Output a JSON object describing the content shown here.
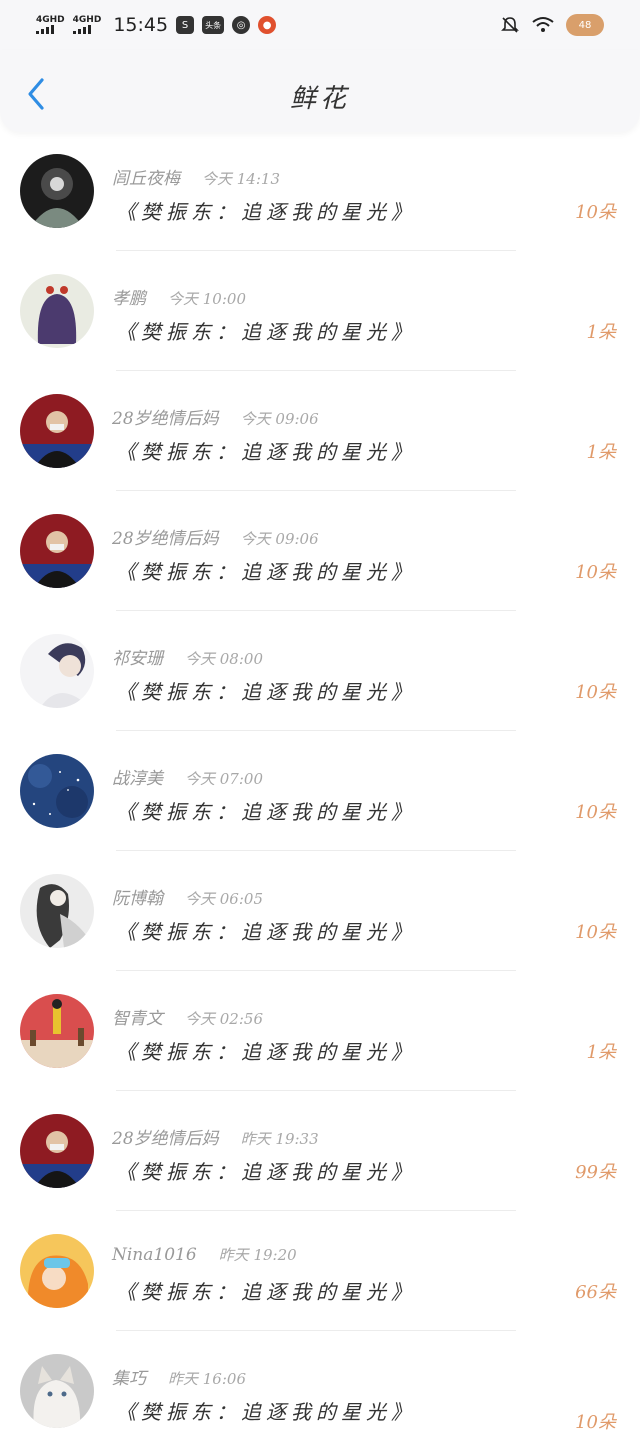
{
  "status_bar": {
    "net1": "4GHD",
    "net2": "4GHD",
    "time": "15:45",
    "app_toutiao": "头条",
    "battery": "48"
  },
  "nav": {
    "title": "鲜花"
  },
  "items": [
    {
      "name": "闾丘夜梅",
      "time": "今天 14:13",
      "title": "《樊振东：追逐我的星光》",
      "count": "10朵",
      "avatar": "avatar-dark-art"
    },
    {
      "name": "孝鹏",
      "time": "今天 10:00",
      "title": "《樊振东：追逐我的星光》",
      "count": "1朵",
      "avatar": "avatar-purple-hair"
    },
    {
      "name": "28岁绝情后妈",
      "time": "今天 09:06",
      "title": "《樊振东：追逐我的星光》",
      "count": "1朵",
      "avatar": "avatar-athlete"
    },
    {
      "name": "28岁绝情后妈",
      "time": "今天 09:06",
      "title": "《樊振东：追逐我的星光》",
      "count": "10朵",
      "avatar": "avatar-athlete"
    },
    {
      "name": "祁安珊",
      "time": "今天 08:00",
      "title": "《樊振东：追逐我的星光》",
      "count": "10朵",
      "avatar": "avatar-portrait"
    },
    {
      "name": "战淳美",
      "time": "今天 07:00",
      "title": "《樊振东：追逐我的星光》",
      "count": "10朵",
      "avatar": "avatar-starry-sky"
    },
    {
      "name": "阮博翰",
      "time": "今天 06:05",
      "title": "《樊振东：追逐我的星光》",
      "count": "10朵",
      "avatar": "avatar-ink-painting"
    },
    {
      "name": "智青文",
      "time": "今天 02:56",
      "title": "《樊振东：追逐我的星光》",
      "count": "1朵",
      "avatar": "avatar-stage"
    },
    {
      "name": "28岁绝情后妈",
      "time": "昨天 19:33",
      "title": "《樊振东：追逐我的星光》",
      "count": "99朵",
      "avatar": "avatar-athlete"
    },
    {
      "name": "Nina1016",
      "time": "昨天 19:20",
      "title": "《樊振东：追逐我的星光》",
      "count": "66朵",
      "avatar": "avatar-cartoon"
    },
    {
      "name": "集巧",
      "time": "昨天 16:06",
      "title": "《樊振东：追逐我的星光》",
      "count": "10朵",
      "avatar": "avatar-cat"
    }
  ]
}
